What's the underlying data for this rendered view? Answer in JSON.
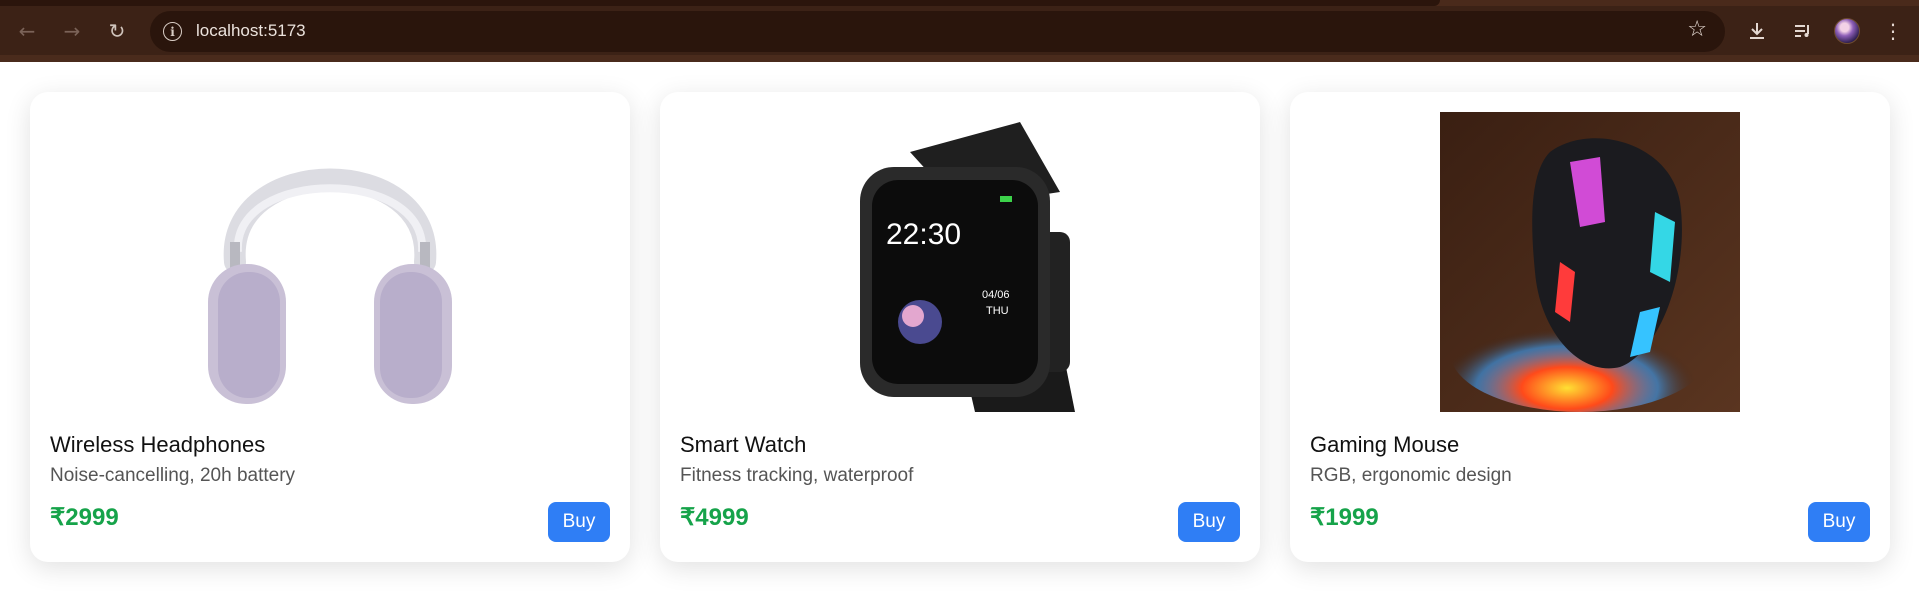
{
  "browser": {
    "url": "localhost:5173"
  },
  "theme": {
    "price_color": "#16a34a",
    "button_color": "#2f7ef5"
  },
  "products": [
    {
      "name": "Wireless Headphones",
      "description": "Noise-cancelling, 20h battery",
      "price": "₹2999",
      "button": "Buy",
      "image": "headphones-image"
    },
    {
      "name": "Smart Watch",
      "description": "Fitness tracking, waterproof",
      "price": "₹4999",
      "button": "Buy",
      "image": "smartwatch-image",
      "watch_time": "22:30",
      "watch_date": "04/06",
      "watch_day": "THU"
    },
    {
      "name": "Gaming Mouse",
      "description": "RGB, ergonomic design",
      "price": "₹1999",
      "button": "Buy",
      "image": "gaming-mouse-image"
    }
  ]
}
